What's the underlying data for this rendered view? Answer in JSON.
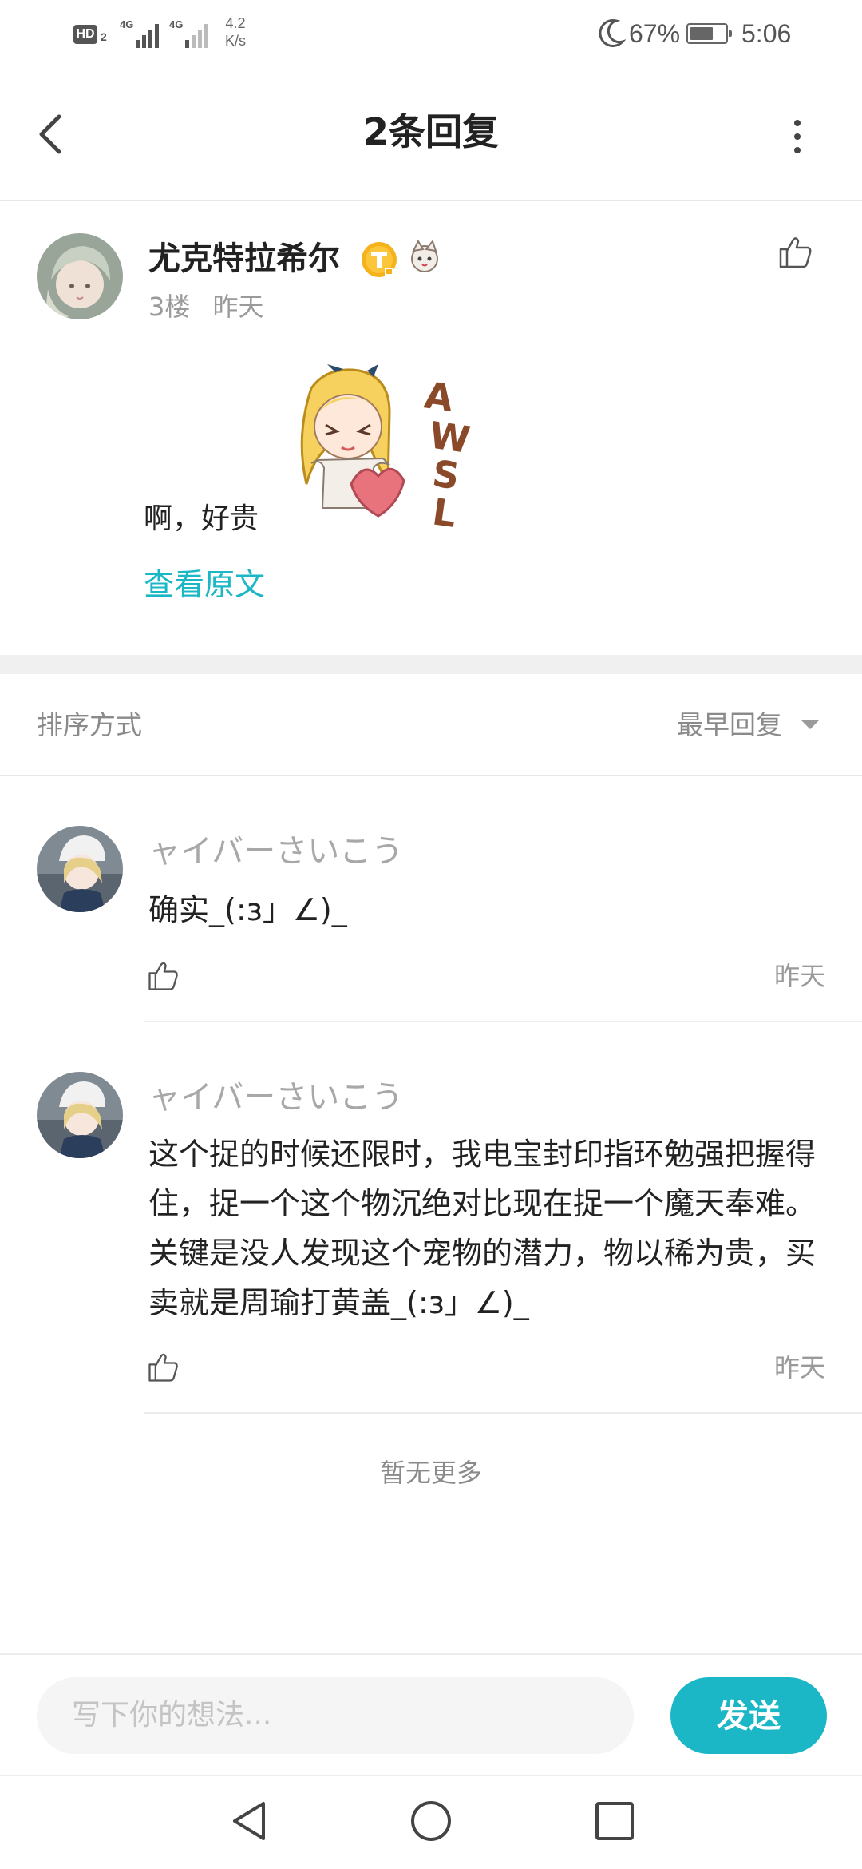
{
  "status_bar": {
    "hd_label": "HD",
    "hd_sub": "2",
    "sim1_label": "4G",
    "sim2_label": "4G",
    "net_speed_value": "4.2",
    "net_speed_unit": "K/s",
    "battery_percent": "67%",
    "battery_level": 0.67,
    "time": "5:06"
  },
  "header": {
    "title": "2条回复",
    "back_icon": "chevron-left-icon",
    "more_icon": "more-vertical-icon"
  },
  "post": {
    "author": "尤克特拉希尔",
    "floor": "3楼",
    "date": "昨天",
    "text": "啊，好贵",
    "sticker_text": "AWSL",
    "view_original": "查看原文"
  },
  "sort": {
    "label": "排序方式",
    "selected": "最早回复"
  },
  "replies": [
    {
      "author": "ャイバーさいこう",
      "text": "确实_(:з」∠)_",
      "time": "昨天"
    },
    {
      "author": "ャイバーさいこう",
      "text": "这个捉的时候还限时，我电宝封印指环勉强把握得住，捉一个这个物沉绝对比现在捉一个魔天奉难。关键是没人发现这个宠物的潜力，物以稀为贵，买卖就是周瑜打黄盖_(:з」∠)_",
      "time": "昨天"
    }
  ],
  "footer": {
    "no_more": "暂无更多",
    "input_placeholder": "写下你的想法...",
    "send_label": "发送"
  },
  "colors": {
    "accent": "#1bb7c6",
    "text_primary": "#222222",
    "text_secondary": "#9a9a9a",
    "divider": "#ececec"
  }
}
